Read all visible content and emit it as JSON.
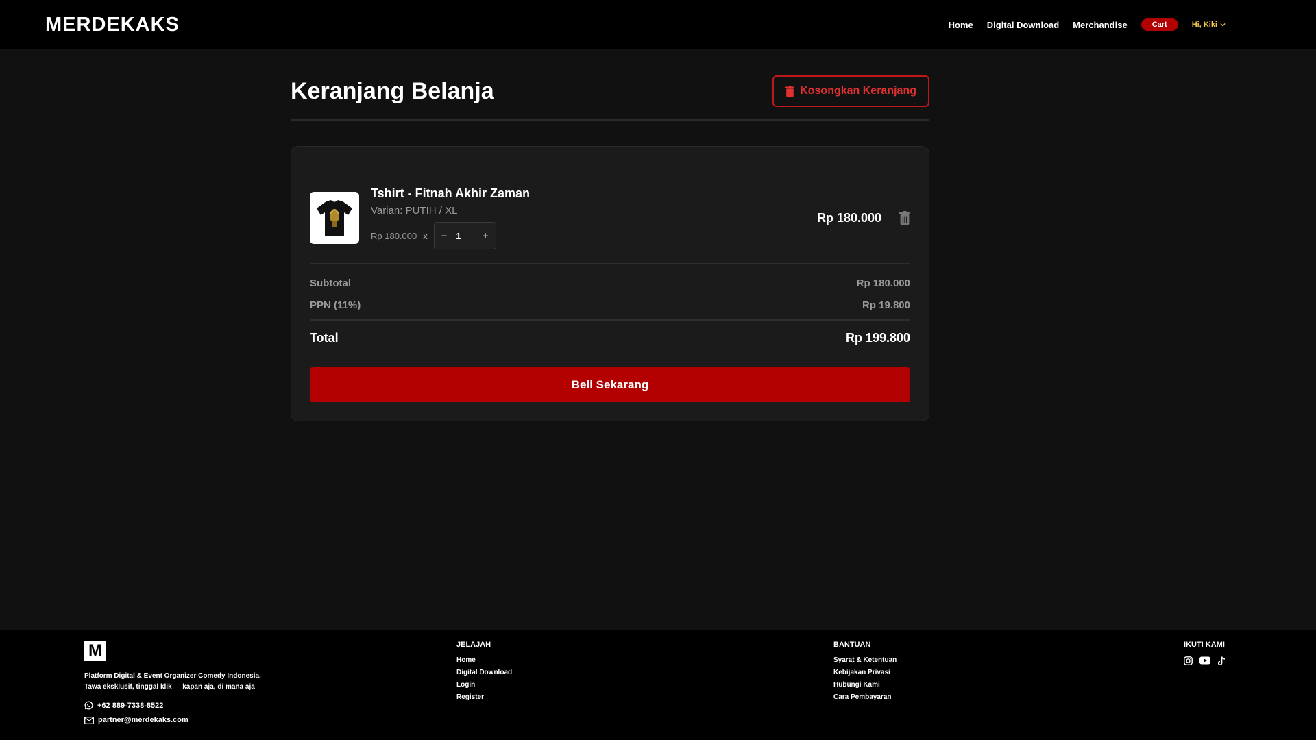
{
  "navbar": {
    "brand": "MERDEKAKS",
    "links": [
      "Home",
      "Digital Download",
      "Merchandise"
    ],
    "cart_label": "Cart",
    "user_label": "Hi, Kiki"
  },
  "page": {
    "title": "Keranjang Belanja",
    "empty_cart_label": "Kosongkan Keranjang"
  },
  "cart": {
    "item": {
      "name": "Tshirt - Fitnah Akhir Zaman",
      "variant": "Varian: PUTIH / XL",
      "unit_price": "Rp 180.000",
      "times": "x",
      "quantity": "1",
      "line_total": "Rp 180.000"
    },
    "subtotal_label": "Subtotal",
    "subtotal_value": "Rp 180.000",
    "tax_label": "PPN (11%)",
    "tax_value": "Rp 19.800",
    "total_label": "Total",
    "total_value": "Rp 199.800",
    "buy_label": "Beli Sekarang"
  },
  "footer": {
    "logo_letter": "M",
    "tagline_1": "Platform Digital & Event Organizer Comedy Indonesia.",
    "tagline_2": "Tawa eksklusif, tinggal klik — kapan aja, di mana aja",
    "phone": "+62 889-7338-8522",
    "email": "partner@merdekaks.com",
    "explore_heading": "JELAJAH",
    "explore_links": [
      "Home",
      "Digital Download",
      "Login",
      "Register"
    ],
    "help_heading": "BANTUAN",
    "help_links": [
      "Syarat & Ketentuan",
      "Kebijakan Privasi",
      "Hubungi Kami",
      "Cara Pembayaran"
    ],
    "follow_heading": "IKUTI KAMI",
    "social_icons": [
      "instagram-icon",
      "youtube-icon",
      "tiktok-icon"
    ]
  },
  "colors": {
    "accent_red": "#b30000",
    "user_yellow": "#f2c94c",
    "background": "#111111"
  }
}
